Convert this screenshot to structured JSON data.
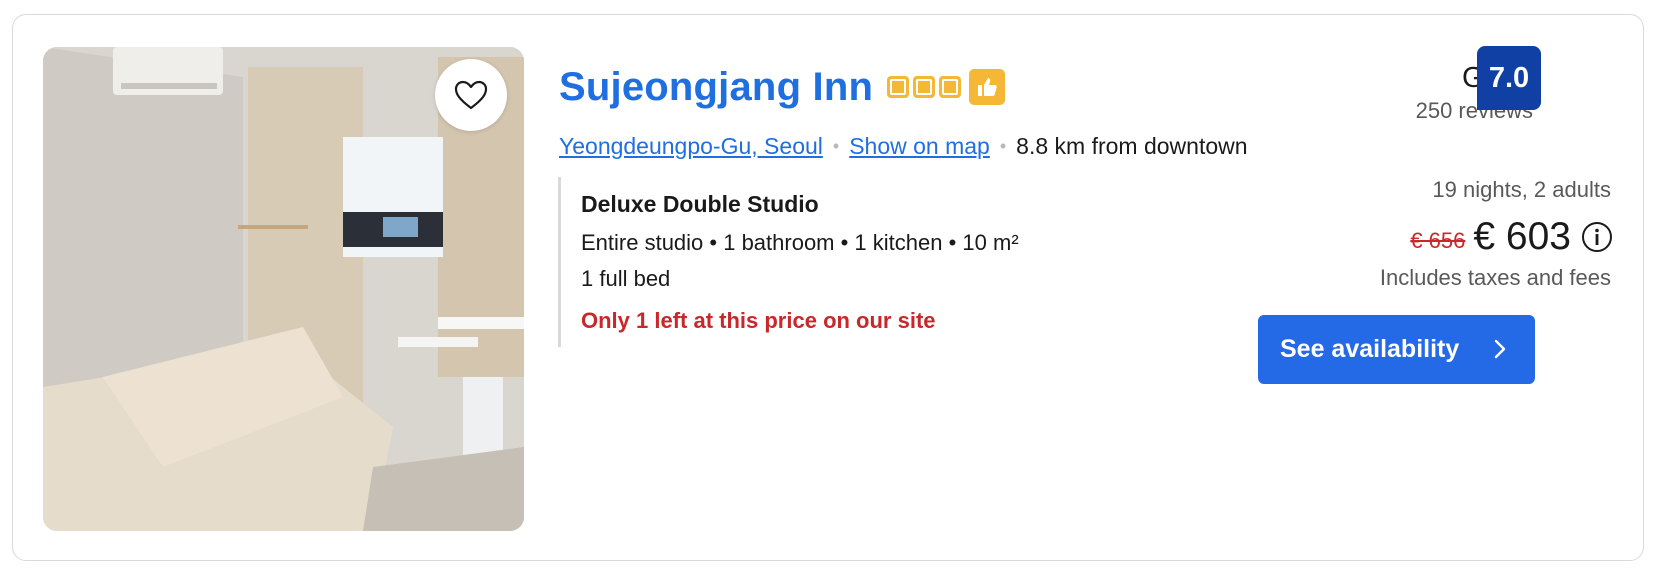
{
  "property": {
    "name": "Sujeongjang Inn",
    "star_icon_count": 3,
    "thumb_icon": "thumbs-up-icon",
    "location_link": "Yeongdeungpo-Gu, Seoul",
    "map_link": "Show on map",
    "distance": "8.8 km from downtown"
  },
  "photo": {
    "favorite_icon": "heart-icon"
  },
  "room": {
    "name": "Deluxe Double Studio",
    "spec": "Entire studio • 1 bathroom • 1 kitchen • 10 m²",
    "beds": "1 full bed",
    "alert": "Only 1 left at this price on our site"
  },
  "review": {
    "word": "Good",
    "count": "250 reviews",
    "score": "7.0"
  },
  "pricing": {
    "stay": "19 nights, 2 adults",
    "old_price": "€ 656",
    "new_price": "€ 603",
    "taxes": "Includes taxes and fees",
    "info_icon": "info-icon"
  },
  "cta": {
    "label": "See availability",
    "icon": "chevron-right-icon"
  },
  "colors": {
    "link": "#1f6fe0",
    "score_badge": "#1040a4",
    "cta": "#2469e6",
    "alert": "#c8282b",
    "stars": "#f5b836"
  }
}
